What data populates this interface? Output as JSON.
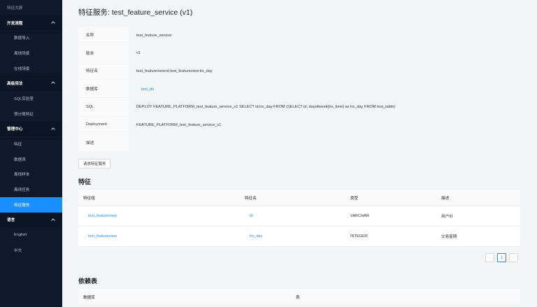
{
  "sidebar": {
    "top_item": "特征大屏",
    "groups": [
      {
        "label": "开发流程",
        "items": [
          "数据导入",
          "离线场景",
          "在线场景"
        ]
      },
      {
        "label": "高级用法",
        "items": [
          "SQL实验室",
          "预计算特征"
        ]
      },
      {
        "label": "管理中心",
        "items": [
          "特征",
          "数据表",
          "离线样本",
          "离线任务",
          "特征服务"
        ]
      },
      {
        "label": "语言",
        "items": [
          "English",
          "中文"
        ]
      }
    ],
    "active_item": "特征服务",
    "colors": {
      "background": "#0e1a2b",
      "active": "#1890ff"
    }
  },
  "page": {
    "title": "特征服务: test_feature_service (v1)"
  },
  "details": {
    "rows": [
      {
        "label": "名称",
        "value": "test_feature_service"
      },
      {
        "label": "版本",
        "value": "v1"
      },
      {
        "label": "特征名",
        "value": "test_featureview:id,test_featureview:trx_day"
      },
      {
        "label": "数据库",
        "value": "test_db"
      },
      {
        "label": "SQL",
        "value": "DEPLOY FEATURE_PLATFORM_test_feature_service_v1 SELECT id,trx_day FROM (SELECT id, dayofweek(trx_time) as trx_day FROM test_table)"
      },
      {
        "label": "Deployment",
        "value": "FEATURE_PLATFORM_test_feature_service_v1"
      },
      {
        "label": "描述",
        "value": ""
      }
    ]
  },
  "request_button": "请求特征服务",
  "features": {
    "title": "特征",
    "columns": [
      "特征组",
      "特征名",
      "类型",
      "描述"
    ],
    "rows": [
      {
        "group": "test_featureview",
        "name": "id",
        "type": "VARCHAR",
        "desc": "用户ID"
      },
      {
        "group": "test_featureview",
        "name": "trx_day",
        "type": "INTEGER",
        "desc": "交易星期"
      }
    ]
  },
  "pagination": {
    "prev": "‹",
    "current": "1",
    "next": "›"
  },
  "dependencies": {
    "title": "依赖表",
    "columns": [
      "数据库",
      "表"
    ]
  }
}
